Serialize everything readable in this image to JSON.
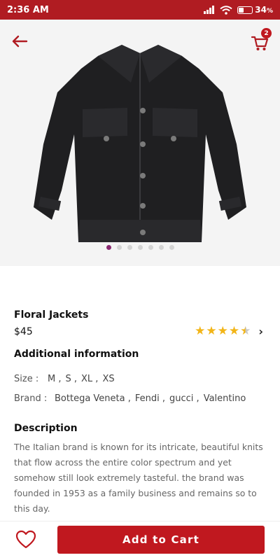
{
  "status_bar": {
    "time": "2:36 AM",
    "battery": "34",
    "battery_unit": "%",
    "battery_level": 0.34
  },
  "header": {
    "back_icon": "arrow-left-icon",
    "cart_icon": "cart-icon",
    "cart_count": "2"
  },
  "carousel": {
    "slide_count": 7,
    "active_index": 0
  },
  "product": {
    "name": "Floral Jackets",
    "price": "$45",
    "rating": 4.5,
    "rating_max": 5
  },
  "additional_info": {
    "title": "Additional information",
    "size_label": "Size :",
    "sizes": [
      "M ,",
      "S ,",
      "XL ,",
      "XS"
    ],
    "brand_label": "Brand :",
    "brands": [
      "Bottega Veneta ,",
      "Fendi ,",
      "gucci ,",
      "Valentino"
    ]
  },
  "description": {
    "title": "Description",
    "text": "The Italian brand is known for its intricate, beautiful knits that flow across the entire color spectrum and yet somehow still look extremely tasteful. the brand was founded in 1953 as a family business and remains so to this day."
  },
  "bottom_bar": {
    "add_to_cart_label": "Add to Cart",
    "wishlist_icon": "heart-outline-icon"
  },
  "colors": {
    "brand_red": "#c0181f",
    "star": "#f2b518",
    "active_dot": "#8a2a72"
  }
}
